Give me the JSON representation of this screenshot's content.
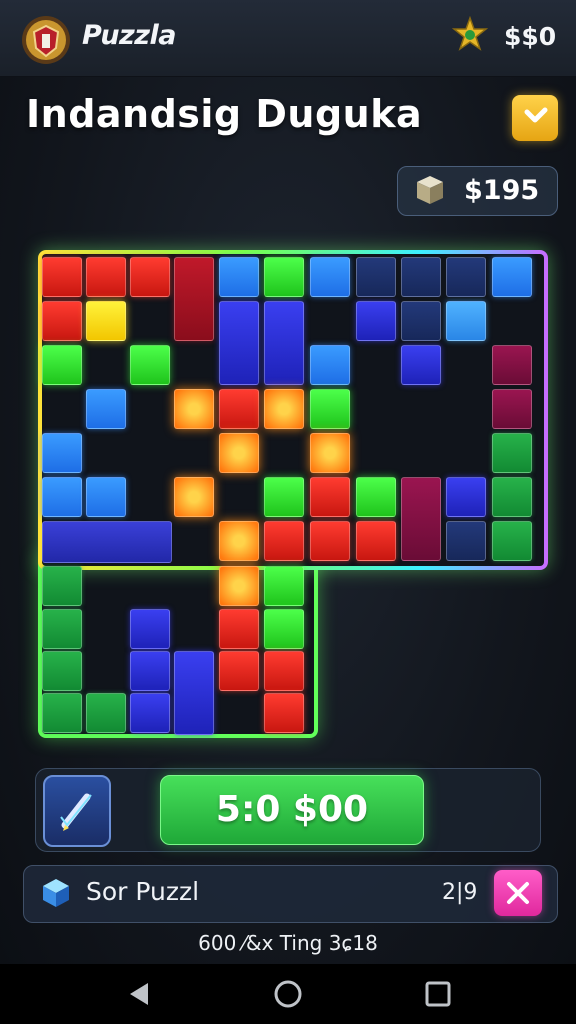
{
  "header": {
    "app_title": "Puzzla",
    "coins": "$$0",
    "logo_icon": "crest-logo-icon",
    "coin_icon": "star-badge-icon"
  },
  "page": {
    "title": "Indandsig Duguka",
    "next_icon": "chevron-right-icon"
  },
  "price": {
    "value": "$195",
    "icon": "treasure-box-icon"
  },
  "board": {
    "colors": {
      "red": "#ff3b30",
      "orange": "#ff8a1a",
      "yellow": "#fff23a",
      "green": "#4cff4a",
      "blue": "#3a9bff",
      "royal": "#3a3ff0",
      "navy": "#23397a",
      "maroon": "#9a1550"
    }
  },
  "actions": {
    "play_label": "5:0 $00",
    "pencil_icon": "pencil-edit-icon"
  },
  "info": {
    "label": "Sor Puzzl",
    "count": "2|9",
    "cube_icon": "cube-icon",
    "close_icon": "close-icon"
  },
  "footer": {
    "text": "600 ⁄&x Ting 3ɕ18"
  },
  "navbar": {
    "back_icon": "back-triangle-icon",
    "home_icon": "home-circle-icon",
    "recents_icon": "recents-square-icon"
  }
}
